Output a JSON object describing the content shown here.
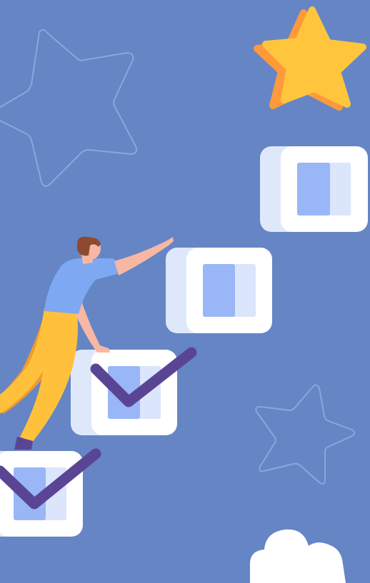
{
  "colors": {
    "background": "#6585c5",
    "star_gold": "#ffc53d",
    "star_orange": "#ff9a3c",
    "box_back": "#dfe8fb",
    "box_front": "#ffffff",
    "box_inner_light": "#dbe5fb",
    "box_inner_blue": "#99b6f7",
    "checkmark": "#5a4595",
    "outline_star": "#8aa6dd",
    "cloud": "#ffffff",
    "shirt": "#7ea8f2",
    "pants": "#ffc13b",
    "pants_shade": "#f09a2e",
    "skin": "#f7b7a3",
    "hair": "#8c4a2f",
    "shoe": "#5a4595"
  },
  "scene": {
    "description_icons": [
      "gold-star-icon",
      "outline-star-icon",
      "checkbox-icon",
      "checkmark-icon",
      "cloud-icon"
    ],
    "steps": [
      {
        "checked": true
      },
      {
        "checked": true
      },
      {
        "checked": false
      },
      {
        "checked": false
      }
    ]
  }
}
